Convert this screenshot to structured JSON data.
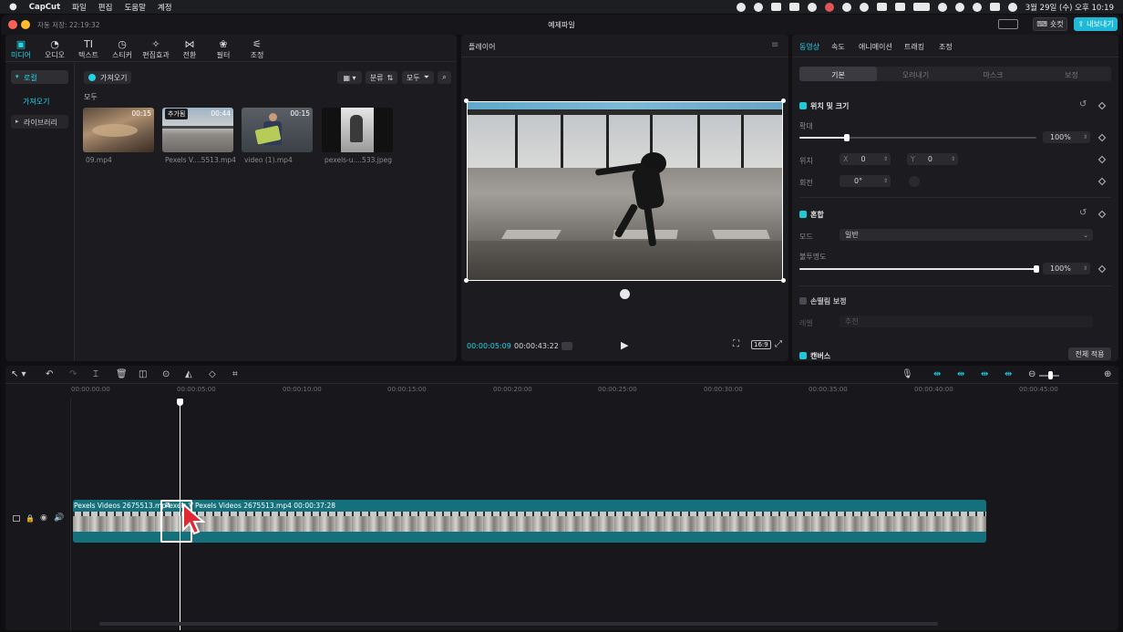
{
  "menubar": {
    "app": "CapCut",
    "items": [
      "파일",
      "편집",
      "도움말",
      "계정"
    ],
    "datetime": "3월 29일 (수) 오후 10:19"
  },
  "titlebar": {
    "autosave": "자동 저장: 22:19:32",
    "project_title": "예제파일",
    "shortcut_label": "숏컷",
    "export_label": "내보내기"
  },
  "toolbar": {
    "tools": [
      "미디어",
      "오디오",
      "텍스트",
      "스티커",
      "편집효과",
      "전환",
      "필터",
      "조정"
    ],
    "active_index": 0
  },
  "media": {
    "sidebar": [
      "로컬",
      "가져오기",
      "라이브러리"
    ],
    "import_label": "가져오기",
    "sort_label": "분류",
    "filter_label": "모두",
    "section_label": "모두",
    "items": [
      {
        "name": "09.mp4",
        "duration": "00:15",
        "badge": ""
      },
      {
        "name": "Pexels V....5513.mp4",
        "duration": "00:44",
        "badge": "추가됨"
      },
      {
        "name": "video (1).mp4",
        "duration": "00:15",
        "badge": ""
      },
      {
        "name": "pexels-u....533.jpeg",
        "duration": "",
        "badge": ""
      }
    ]
  },
  "player": {
    "title": "플레이어",
    "current_time": "00:00:05:09",
    "total_time": "00:00:43:22",
    "aspect": "16:9"
  },
  "properties": {
    "tabs": [
      "동영상",
      "속도",
      "애니메이션",
      "트래킹",
      "조정"
    ],
    "active_tab": 0,
    "subtabs": [
      "기본",
      "오려내기",
      "마스크",
      "보정"
    ],
    "section_position": "위치 및 크기",
    "scale_label": "확대",
    "scale_value": "100%",
    "scale_fraction": 0.2,
    "position_label": "위치",
    "x_label": "X",
    "x_value": "0",
    "y_label": "Y",
    "y_value": "0",
    "rotate_label": "회전",
    "rotate_value": "0°",
    "section_blend": "혼합",
    "mode_label": "모드",
    "mode_value": "일반",
    "opacity_label": "불투명도",
    "opacity_value": "100%",
    "opacity_fraction": 1.0,
    "section_stabilize": "손떨림 보정",
    "stabilize_label": "레벨",
    "stabilize_value": "추천",
    "section_canvas": "캔버스",
    "apply_all_label": "전체 적용"
  },
  "timeline": {
    "ticks": [
      "00:00:00:00",
      "00:00:05:00",
      "00:00:10:00",
      "00:00:15:00",
      "00:00:20:00",
      "00:00:25:00",
      "00:00:30:00",
      "00:00:35:00",
      "00:00:40:00",
      "00:00:45:00"
    ],
    "clip1_label": "Pexels Videos 2675513.mp4",
    "clip2_label": "Pexels V",
    "clip3_label": "Pexels Videos 2675513.mp4   00:00:37:28"
  },
  "colors": {
    "accent": "#22d3e6",
    "clip": "#14707a",
    "export": "#1fb8d6"
  }
}
